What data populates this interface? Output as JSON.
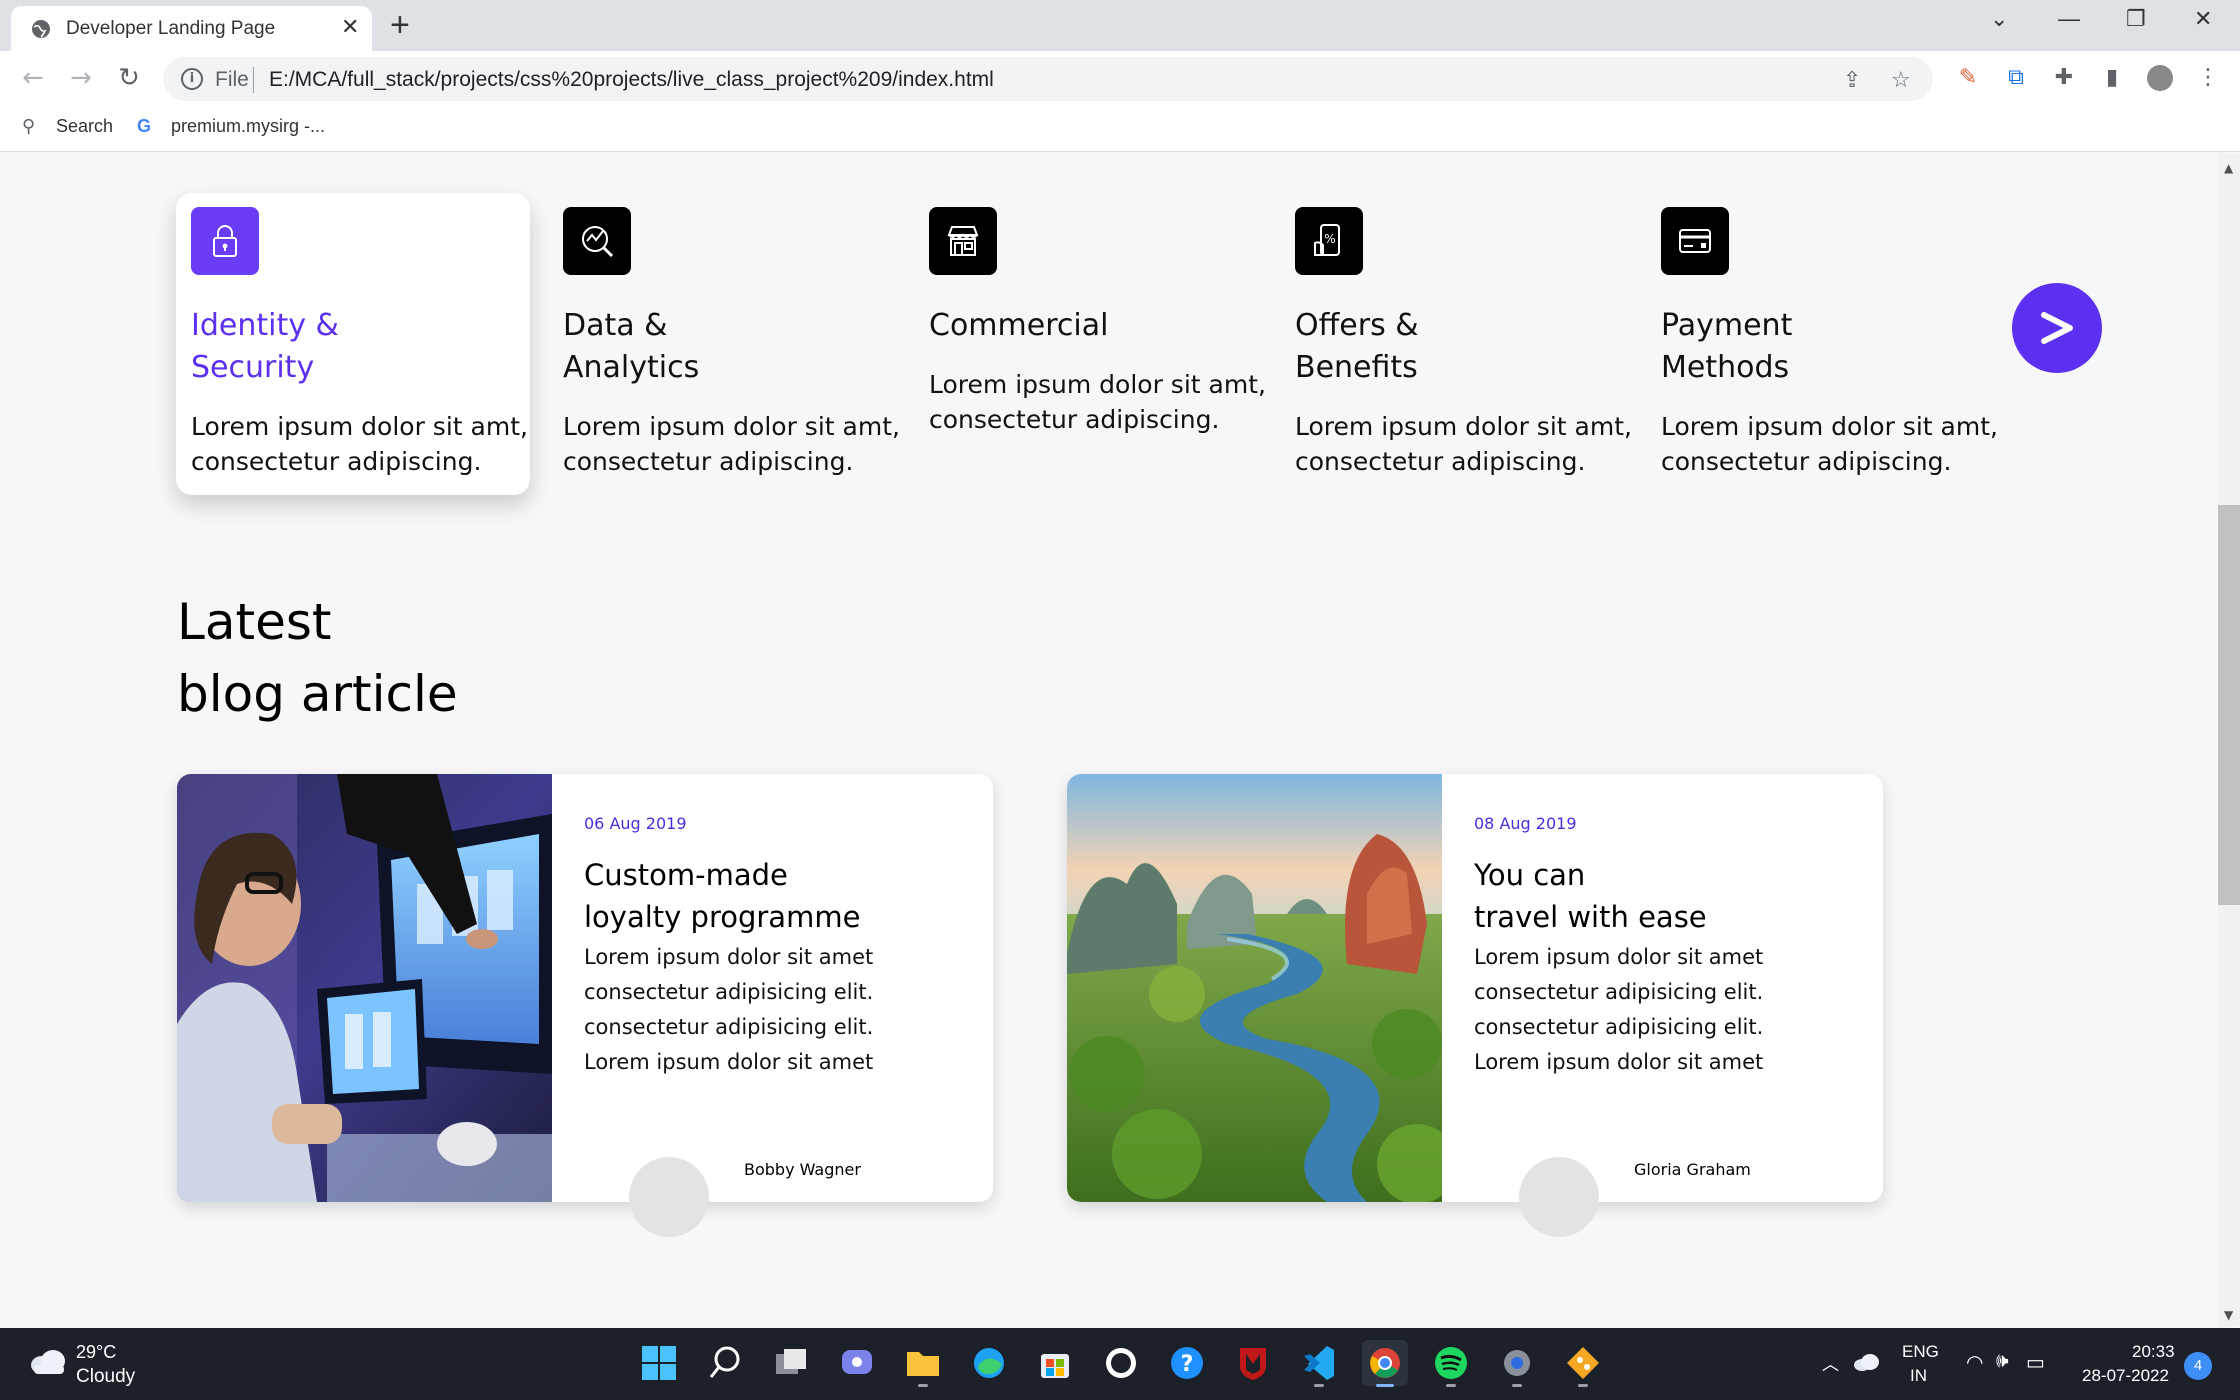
{
  "browser": {
    "tab_title": "Developer Landing Page",
    "tab_close": "✕",
    "new_tab": "+",
    "window_controls": [
      "⌄",
      "—",
      "❐",
      "✕"
    ],
    "omnibox_scheme": "File",
    "url": "E:/MCA/full_stack/projects/css%20projects/live_class_project%209/index.html",
    "bookmarks": [
      "Search",
      "premium.mysirg -..."
    ]
  },
  "features": [
    {
      "title": "Identity &\nSecurity",
      "desc": "Lorem ipsum dolor sit amt,\nconsectetur adipiscing.",
      "icon": "lock-icon",
      "active": true
    },
    {
      "title": "Data &\nAnalytics",
      "desc": "Lorem ipsum dolor sit amt,\nconsectetur adipiscing.",
      "icon": "analytics-icon",
      "active": false
    },
    {
      "title": "Commercial",
      "desc": "Lorem ipsum dolor sit amt,\nconsectetur adipiscing.",
      "icon": "store-icon",
      "active": false
    },
    {
      "title": "Offers &\nBenefits",
      "desc": "Lorem ipsum dolor sit amt,\nconsectetur adipiscing.",
      "icon": "phone-offer-icon",
      "active": false
    },
    {
      "title": "Payment\nMethods",
      "desc": "Lorem ipsum dolor sit amt,\nconsectetur adipiscing.",
      "icon": "card-icon",
      "active": false
    }
  ],
  "next_button_label": ">",
  "section_title": "Latest\nblog article",
  "blog": [
    {
      "date": "06 Aug 2019",
      "title": "Custom-made\nloyalty programme",
      "desc": "Lorem ipsum dolor sit amet\nconsectetur adipisicing elit.\nconsectetur adipisicing elit.\nLorem ipsum dolor sit amet",
      "author": "Bobby Wagner",
      "image": "developer-at-computer-photo"
    },
    {
      "date": "08 Aug 2019",
      "title": "You can\ntravel with ease",
      "desc": "Lorem ipsum dolor sit amet\nconsectetur adipisicing elit.\nconsectetur adipisicing elit.\nLorem ipsum dolor sit amet",
      "author": "Gloria Graham",
      "image": "river-landscape-photo"
    }
  ],
  "taskbar": {
    "temperature": "29°C",
    "weather": "Cloudy",
    "lang_top": "ENG",
    "lang_bottom": "IN",
    "time": "20:33",
    "date": "28-07-2022",
    "notifications": "4"
  },
  "colors": {
    "accent": "#5b30f0",
    "date_text": "#4b2ce0",
    "taskbar": "#1c2129"
  }
}
